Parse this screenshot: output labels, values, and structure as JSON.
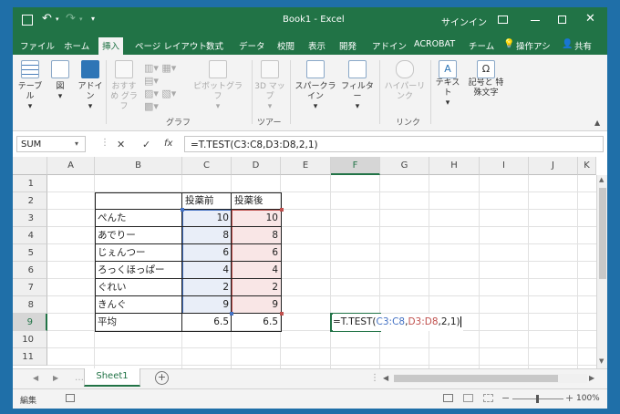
{
  "window": {
    "title": "Book1 - Excel",
    "signin": "サインイン"
  },
  "tabs": [
    "ファイル",
    "ホーム",
    "挿入",
    "ページ レイアウト",
    "数式",
    "データ",
    "校閲",
    "表示",
    "開発",
    "アドイン",
    "ACROBAT",
    "チーム",
    "操作アシ",
    "共有"
  ],
  "ribbon": {
    "table": "テーブル",
    "illustration": "図",
    "addin": "アドイン",
    "recommended_chart": "おすすめ グラフ",
    "pivot_chart": "ピボットグラフ",
    "map3d": "3D マップ",
    "sparkline": "スパークライン",
    "filter": "フィルター",
    "hyperlink": "ハイパーリンク",
    "text": "テキスト",
    "symbol": "記号と 特殊文字",
    "group_chart": "グラフ",
    "group_tour": "ツアー",
    "group_link": "リンク"
  },
  "formula_bar": {
    "name_box": "SUM",
    "formula": "=T.TEST(C3:C8,D3:D8,2,1)",
    "cancel": "✕",
    "enter": "✓",
    "fx": "fx"
  },
  "columns": [
    "A",
    "B",
    "C",
    "D",
    "E",
    "F",
    "G",
    "H",
    "I",
    "J",
    "K"
  ],
  "rows": [
    "1",
    "2",
    "3",
    "4",
    "5",
    "6",
    "7",
    "8",
    "9",
    "10",
    "11"
  ],
  "table": {
    "header_before": "投薬前",
    "header_after": "投薬後",
    "names": [
      "ぺんた",
      "あでりー",
      "じぇんつー",
      "ろっくほっぱー",
      "ぐれい",
      "きんぐ"
    ],
    "before": [
      "10",
      "8",
      "6",
      "4",
      "2",
      "9"
    ],
    "after": [
      "10",
      "8",
      "6",
      "4",
      "2",
      "9"
    ],
    "avg_label": "平均",
    "avg_before": "6.5",
    "avg_after": "6.5"
  },
  "edit_cell": {
    "prefix": "=T.TEST(",
    "ref1": "C3:C8",
    "comma1": ",",
    "ref2": "D3:D8",
    "suffix": ",2,1)"
  },
  "colors": {
    "excel_green": "#217346",
    "ref_blue": "#4472c4",
    "ref_red": "#c0504d"
  },
  "sheet": {
    "tab": "Sheet1"
  },
  "status": {
    "mode": "編集",
    "zoom": "100%"
  }
}
